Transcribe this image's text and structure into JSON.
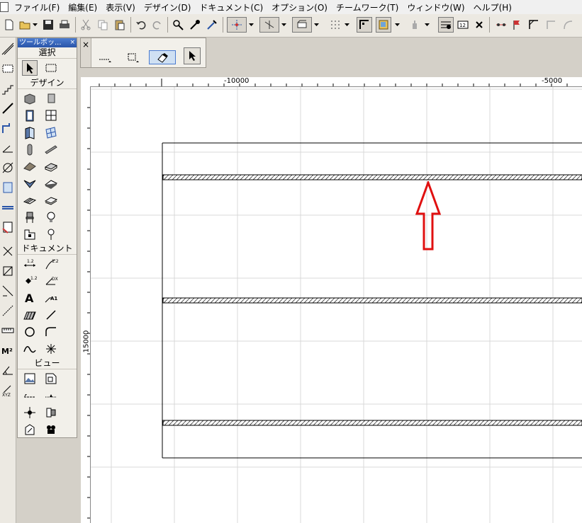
{
  "menu": {
    "items": [
      "ファイル(F)",
      "編集(E)",
      "表示(V)",
      "デザイン(D)",
      "ドキュメント(C)",
      "オプション(O)",
      "チームワーク(T)",
      "ウィンドウ(W)",
      "ヘルプ(H)"
    ]
  },
  "toolbox": {
    "title": "ツールボッ...",
    "close": "×",
    "sections": {
      "select": "選択",
      "design": "デザイン",
      "document": "ドキュメント",
      "view": "ビュー"
    }
  },
  "toolbar_icons": [
    "new-file",
    "open",
    "save",
    "print",
    "cut",
    "copy",
    "paste",
    "undo",
    "redo",
    "find-select",
    "eyedropper",
    "syringe",
    "snap-guide",
    "gravity",
    "layer-combo",
    "grid",
    "floor-plan",
    "3d-window",
    "elevation",
    "favorites",
    "dimension-text",
    "marquee",
    "trace",
    "flag",
    "corner-tool",
    "arc-tool"
  ],
  "ruler": {
    "h_labels": [
      "-10000",
      "-5000"
    ],
    "v_label": "15000"
  },
  "info_box": {
    "close": "×"
  },
  "drawing": {
    "annotation": "red-up-arrow",
    "accent_color": "#e01010"
  },
  "colors": {
    "menubar": "#f0f0f0",
    "titlebar": "#2a55a8",
    "canvas": "#ffffff",
    "grid": "#d8d8d8"
  }
}
